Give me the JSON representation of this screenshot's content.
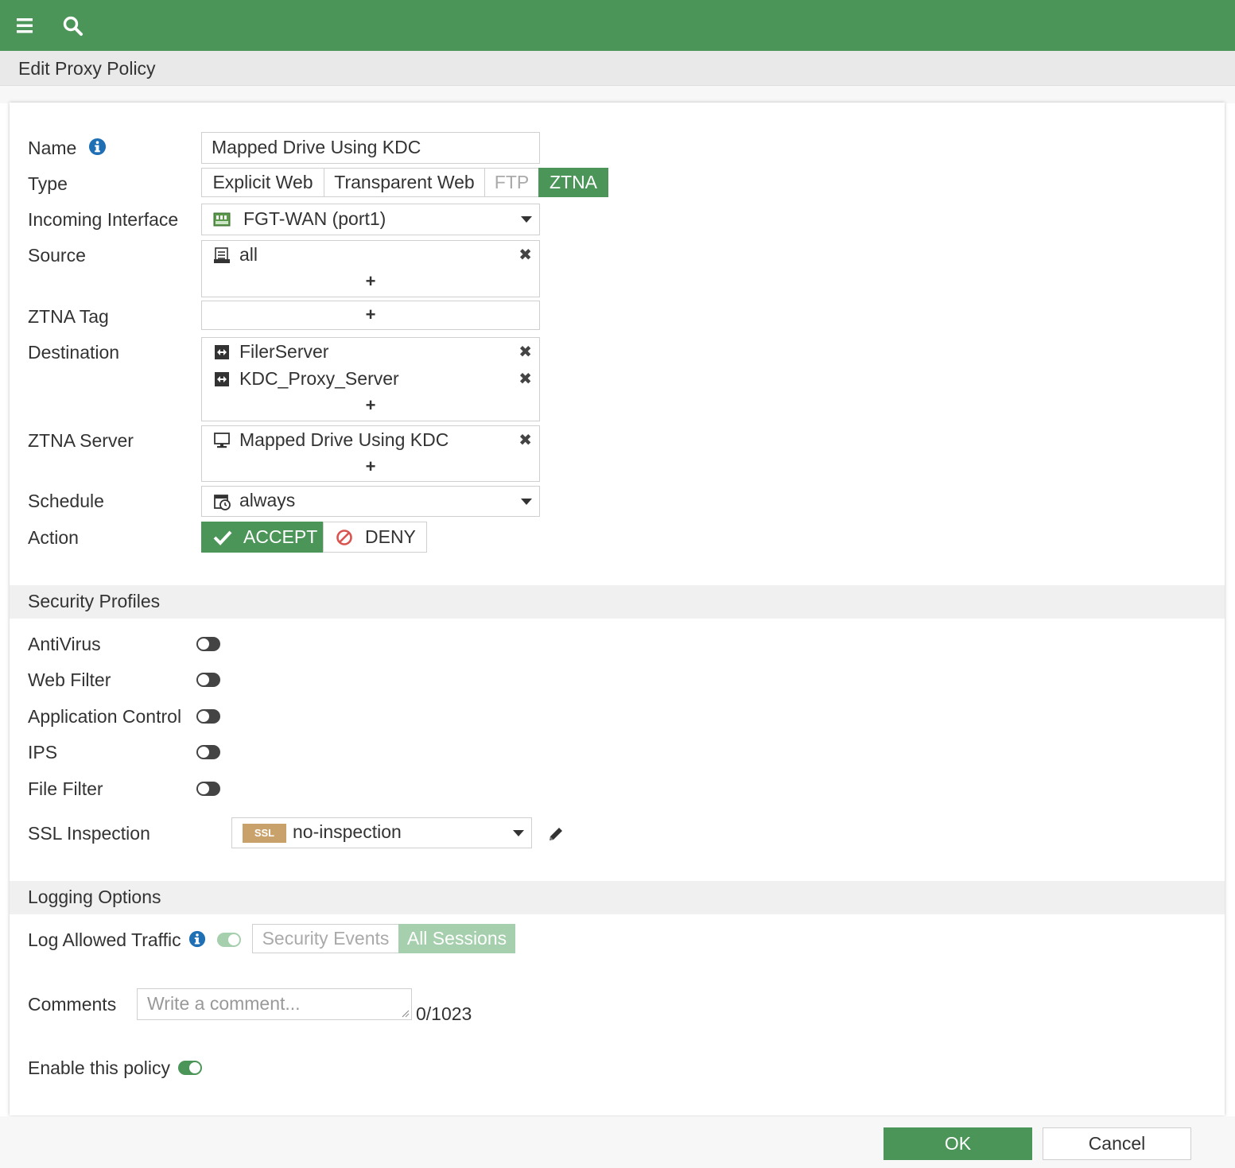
{
  "header": {
    "menu_icon": "hamburger-menu-icon",
    "search_icon": "search-icon"
  },
  "page": {
    "title": "Edit Proxy Policy"
  },
  "form": {
    "name": {
      "label": "Name",
      "value": "Mapped Drive Using KDC",
      "info_icon": "info-icon"
    },
    "type": {
      "label": "Type",
      "options": [
        "Explicit Web",
        "Transparent Web",
        "FTP",
        "ZTNA"
      ],
      "selected": "ZTNA"
    },
    "incoming_interface": {
      "label": "Incoming Interface",
      "value": "FGT-WAN (port1)",
      "icon": "interface-port-icon"
    },
    "source": {
      "label": "Source",
      "entries": [
        "all"
      ],
      "add": "+"
    },
    "ztna_tag": {
      "label": "ZTNA Tag",
      "add": "+"
    },
    "destination": {
      "label": "Destination",
      "entries": [
        "FilerServer",
        "KDC_Proxy_Server"
      ],
      "add": "+"
    },
    "ztna_server": {
      "label": "ZTNA Server",
      "entries": [
        "Mapped Drive Using KDC"
      ],
      "add": "+"
    },
    "schedule": {
      "label": "Schedule",
      "value": "always"
    },
    "action": {
      "label": "Action",
      "accept": "ACCEPT",
      "deny": "DENY",
      "selected": "ACCEPT"
    }
  },
  "security_profiles": {
    "header": "Security Profiles",
    "items": [
      {
        "label": "AntiVirus",
        "enabled": false
      },
      {
        "label": "Web Filter",
        "enabled": false
      },
      {
        "label": "Application Control",
        "enabled": false
      },
      {
        "label": "IPS",
        "enabled": false
      },
      {
        "label": "File Filter",
        "enabled": false
      }
    ],
    "ssl_inspection": {
      "label": "SSL Inspection",
      "badge": "SSL",
      "value": "no-inspection"
    }
  },
  "logging": {
    "header": "Logging Options",
    "log_allowed_traffic": {
      "label": "Log Allowed Traffic",
      "enabled": true,
      "options": [
        "Security Events",
        "All Sessions"
      ],
      "selected": "All Sessions"
    },
    "comments": {
      "label": "Comments",
      "placeholder": "Write a comment...",
      "counter": "0/1023"
    },
    "enable_policy": {
      "label": "Enable this policy",
      "enabled": true
    }
  },
  "footer": {
    "ok": "OK",
    "cancel": "Cancel"
  },
  "colors": {
    "brand_green": "#4c9558",
    "deny_red": "#d9534f",
    "ssl_badge": "#c9a26b",
    "info_blue": "#1f6fb5"
  }
}
